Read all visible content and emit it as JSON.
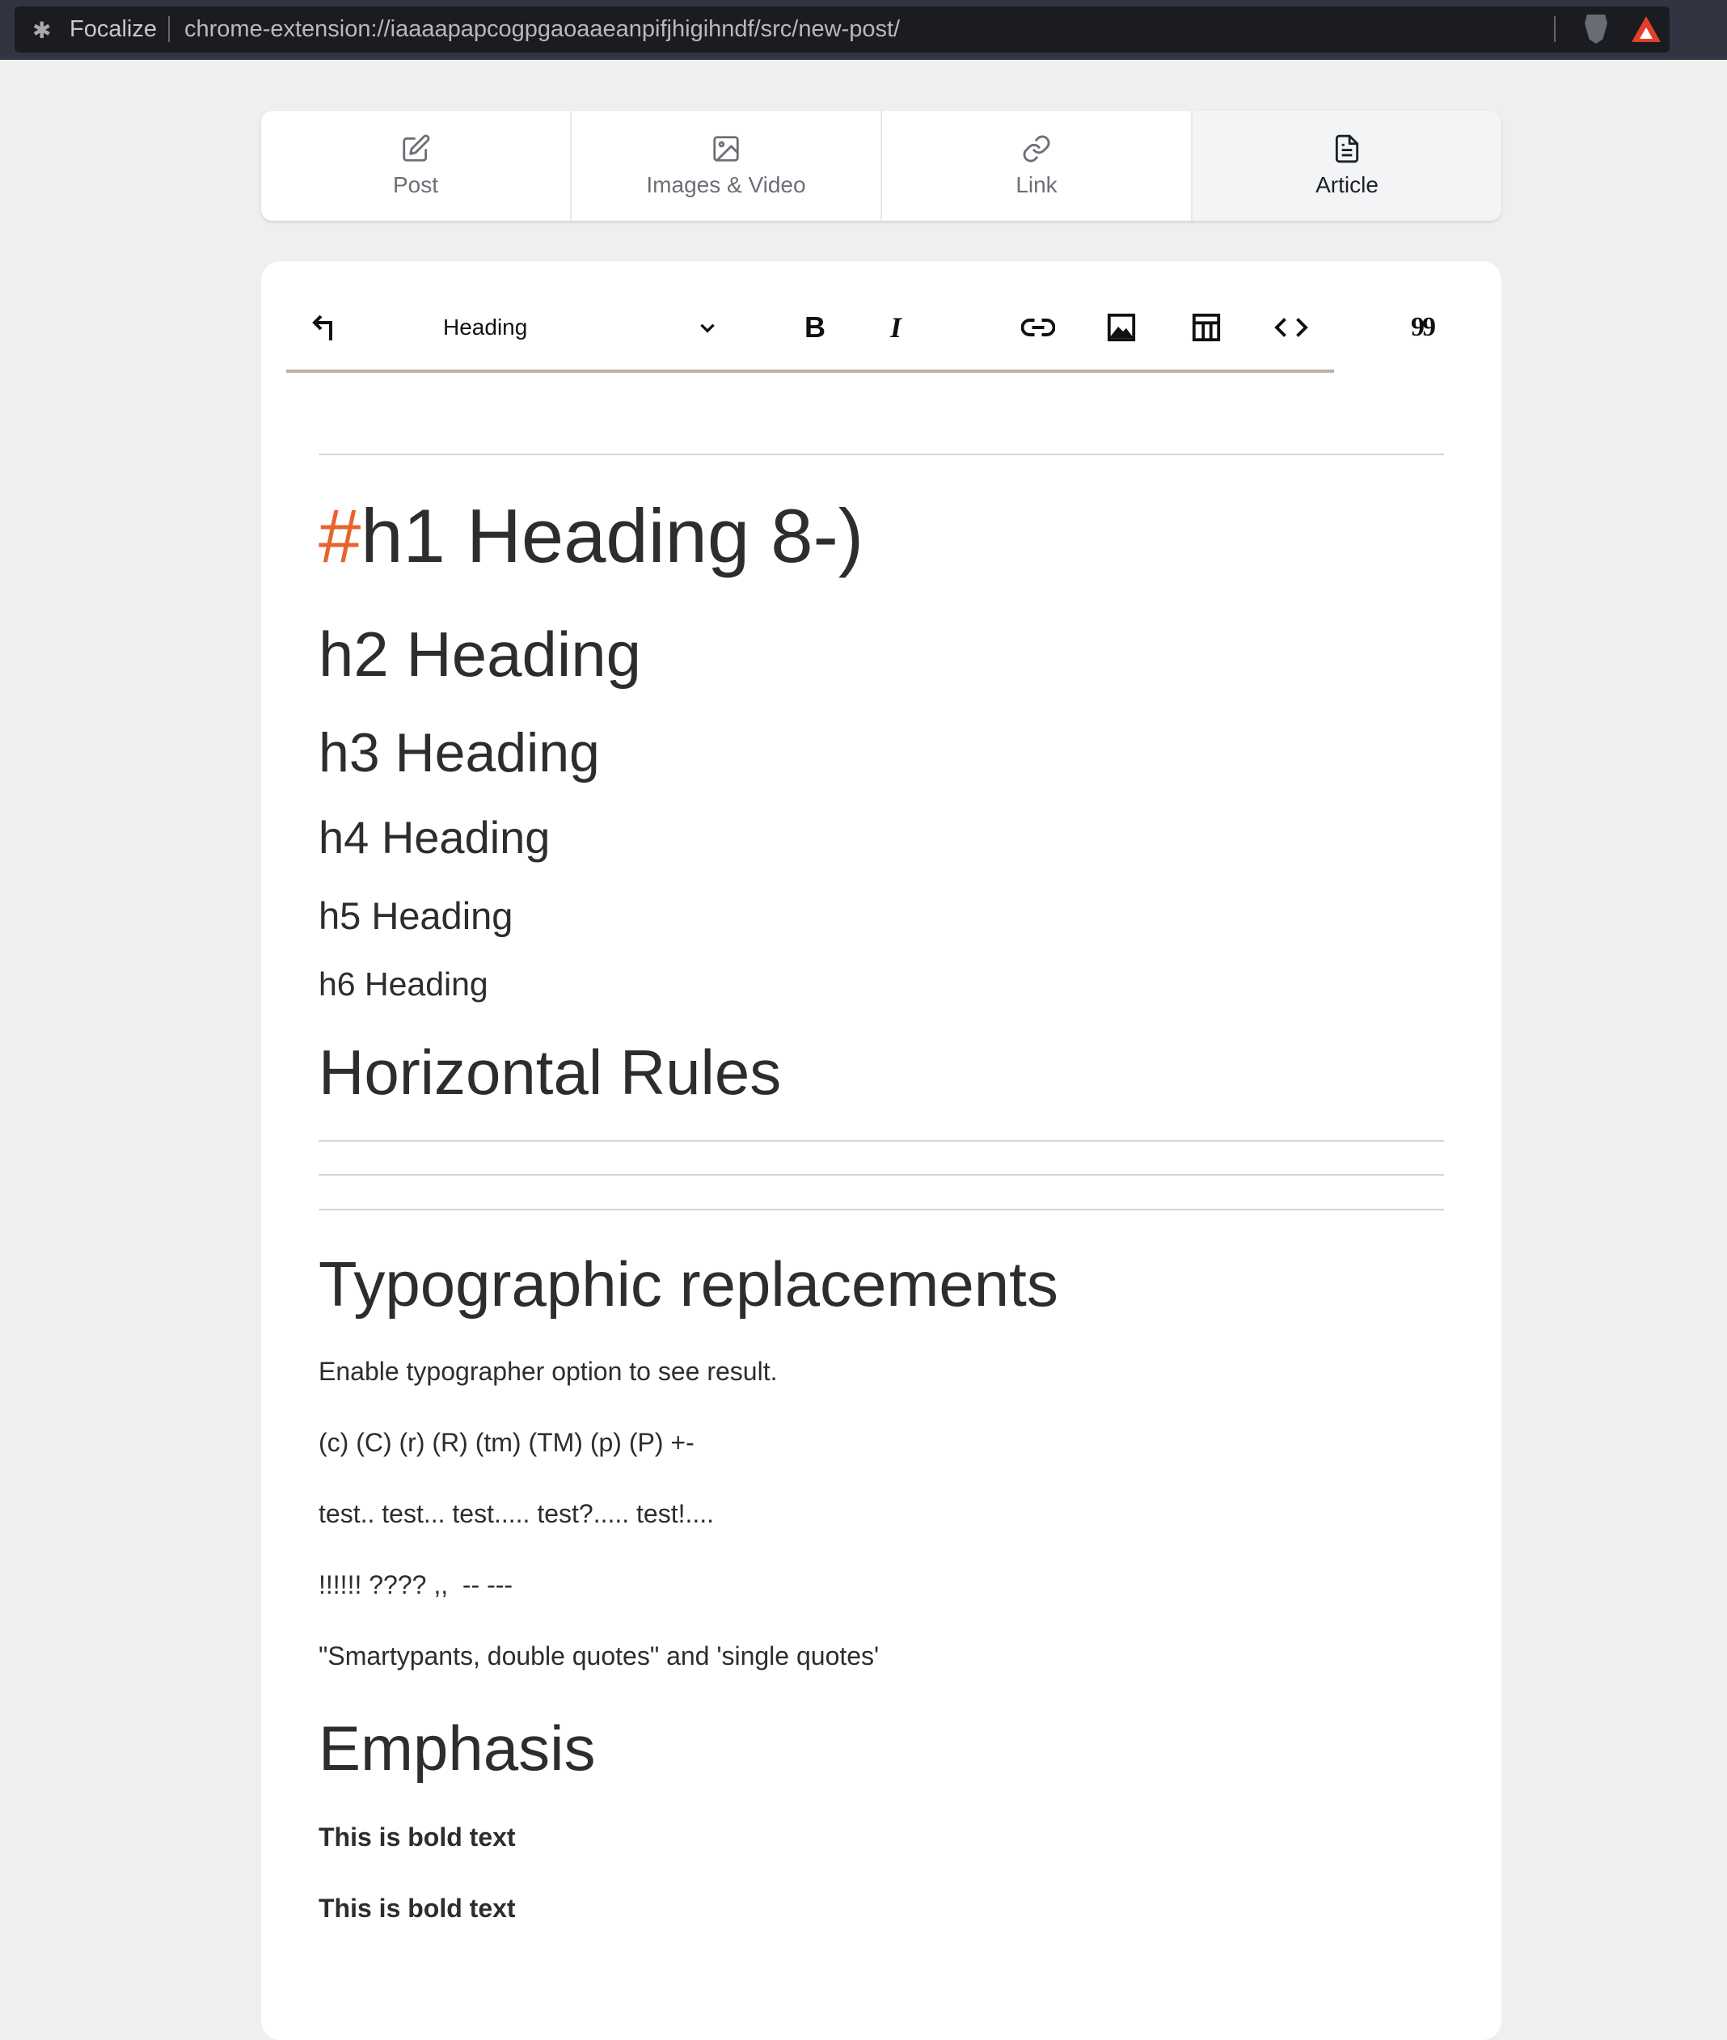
{
  "browser": {
    "extension_name": "Focalize",
    "url": "chrome-extension://iaaaapapcogpgaoaaeanpifjhigihndf/src/new-post/"
  },
  "tabs": [
    {
      "label": "Post",
      "icon": "pencil-square-icon"
    },
    {
      "label": "Images & Video",
      "icon": "image-icon"
    },
    {
      "label": "Link",
      "icon": "link-icon"
    },
    {
      "label": "Article",
      "icon": "document-icon",
      "active": true
    }
  ],
  "toolbar": {
    "undo_icon": "undo-arrow-icon",
    "block_type": "Heading",
    "buttons": [
      "bold",
      "italic",
      "link",
      "image",
      "table",
      "code",
      "quote"
    ],
    "bold_glyph": "B",
    "italic_glyph": "I",
    "quote_glyph": "99",
    "accent": "#c4ada2"
  },
  "content": {
    "h1_hash": "#",
    "h1": "h1 Heading 8-)",
    "h2": "h2 Heading",
    "h3": "h3 Heading",
    "h4": "h4 Heading",
    "h5": "h5 Heading",
    "h6": "h6 Heading",
    "hr_heading": "Horizontal Rules",
    "typo_heading": "Typographic replacements",
    "typo_p1": "Enable typographer option to see result.",
    "typo_p2": "(c) (C) (r) (R) (tm) (TM) (p) (P) +-",
    "typo_p3": "test.. test... test..... test?..... test!....",
    "typo_p4": "!!!!!! ???? ,,  -- ---",
    "typo_p5": "\"Smartypants, double quotes\" and 'single quotes'",
    "emph_heading": "Emphasis",
    "bold1": "This is bold text",
    "bold2": "This is bold text",
    "hash_color": "#e8632b"
  }
}
